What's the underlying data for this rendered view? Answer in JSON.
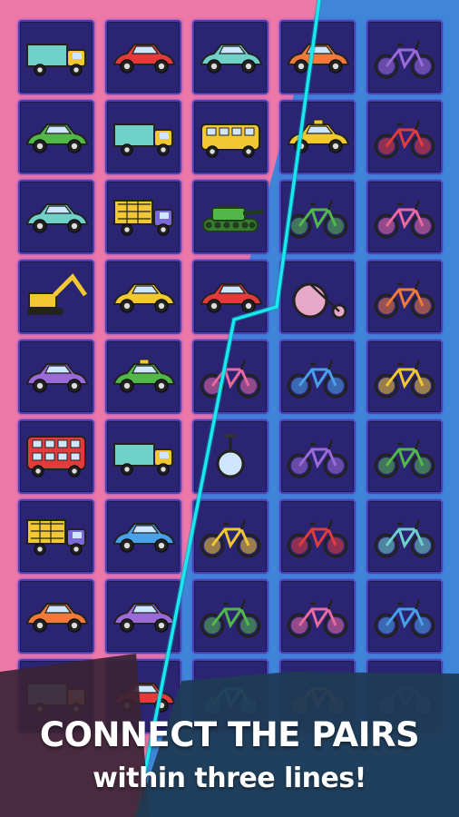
{
  "game": {
    "headline_line1": "CONNECT THE PAIRS",
    "headline_line2": "within three lines!",
    "colors": {
      "left_background": "#ee78a8",
      "right_background": "#3f86d8",
      "tile_fill": "#2a2472",
      "tile_border": "#4a3fb5",
      "connector_line": "#18e8f0"
    },
    "board": {
      "columns": 5,
      "rows": 9,
      "tiles": [
        [
          "truck-icon",
          "vintage-car-icon",
          "convertible-car-icon",
          "sedan-car-icon",
          "bicycle-icon"
        ],
        [
          "sedan-car-icon",
          "pickup-truck-icon",
          "school-bus-icon",
          "taxi-icon",
          "bicycle-icon"
        ],
        [
          "sports-car-icon",
          "dump-truck-icon",
          "tank-icon",
          "tricycle-cart-icon",
          "bicycle-icon"
        ],
        [
          "excavator-icon",
          "sedan-car-icon",
          "sedan-car-icon",
          "penny-farthing-icon",
          "bicycle-icon"
        ],
        [
          "compact-car-icon",
          "taxi-icon",
          "recumbent-bike-icon",
          "bicycle-icon",
          "folding-bike-icon"
        ],
        [
          "double-decker-bus-icon",
          "delivery-truck-icon",
          "unicycle-icon",
          "bicycle-icon",
          "bicycle-icon"
        ],
        [
          "dump-truck-icon",
          "vintage-car-icon",
          "scooter-bike-icon",
          "bicycle-icon",
          "bicycle-icon"
        ],
        [
          "convertible-car-icon",
          "sedan-car-icon",
          "kids-bike-icon",
          "bmx-bike-icon",
          "bicycle-icon"
        ],
        [
          "pickup-truck-icon",
          "compact-car-icon",
          "delivery-bike-icon",
          "bicycle-icon",
          "cargo-bike-icon"
        ]
      ]
    }
  }
}
